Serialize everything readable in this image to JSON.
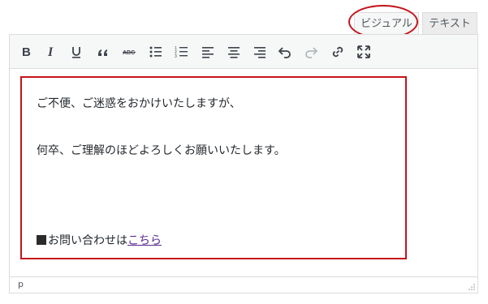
{
  "tabs": {
    "visual": "ビジュアル",
    "text": "テキスト"
  },
  "toolbar": {
    "buttons": [
      {
        "name": "bold-icon"
      },
      {
        "name": "italic-icon"
      },
      {
        "name": "underline-icon"
      },
      {
        "name": "blockquote-icon"
      },
      {
        "name": "strikethrough-icon"
      },
      {
        "name": "bulleted-list-icon"
      },
      {
        "name": "numbered-list-icon"
      },
      {
        "name": "align-left-icon"
      },
      {
        "name": "align-center-icon"
      },
      {
        "name": "align-right-icon"
      },
      {
        "name": "undo-icon"
      },
      {
        "name": "redo-icon"
      },
      {
        "name": "link-icon"
      },
      {
        "name": "fullscreen-icon"
      }
    ]
  },
  "content": {
    "line1": "ご不便、ご迷惑をおかけいたしますが、",
    "line2": "何卒、ご理解のほどよろしくお願いいたします。",
    "line3_prefix": "お問い合わせは",
    "line3_link": "こちら"
  },
  "status": {
    "path": "p"
  },
  "colors": {
    "highlight": "#c3141b",
    "link": "#5b2b91"
  }
}
